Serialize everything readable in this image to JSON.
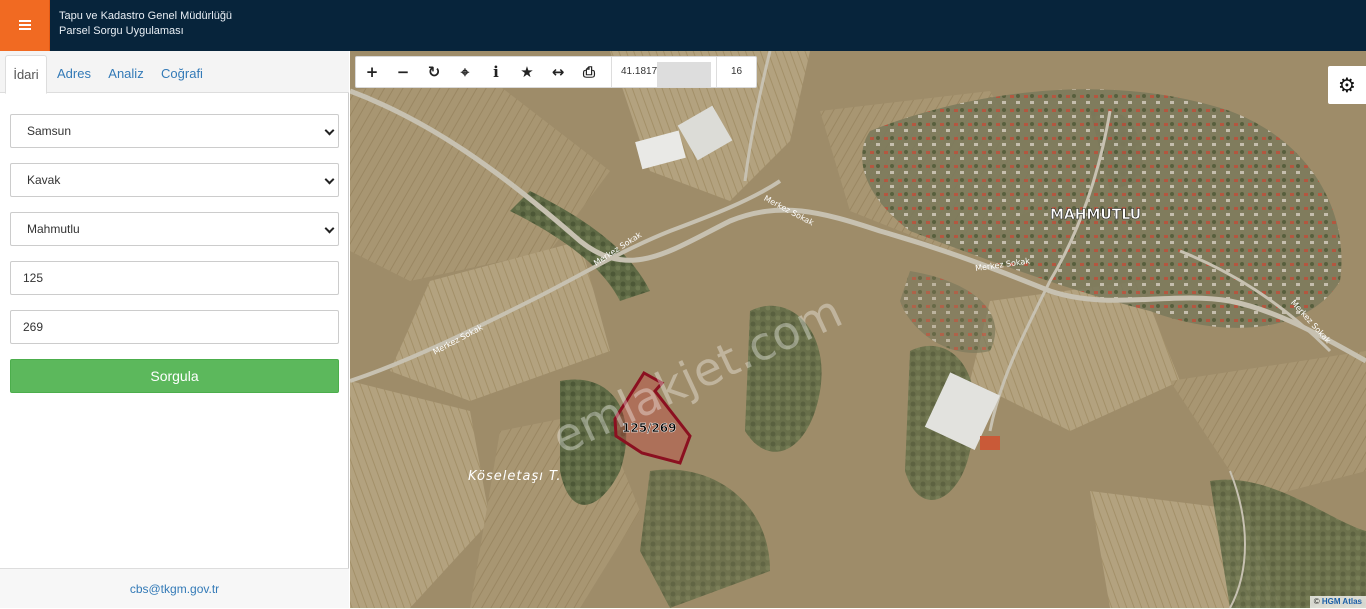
{
  "header": {
    "title_line1": "Tapu ve Kadastro Genel Müdürlüğü",
    "title_line2": "Parsel Sorgu Uygulaması",
    "menu_icon": "hamburger-icon"
  },
  "sidebar": {
    "tabs": [
      {
        "label": "İdari",
        "active": true
      },
      {
        "label": "Adres",
        "active": false
      },
      {
        "label": "Analiz",
        "active": false
      },
      {
        "label": "Coğrafi",
        "active": false
      }
    ],
    "form": {
      "il": "Samsun",
      "ilce": "Kavak",
      "mahalle": "Mahmutlu",
      "ada": "125",
      "parsel": "269",
      "submit_label": "Sorgula"
    },
    "footer_email": "cbs@tkgm.gov.tr"
  },
  "map": {
    "toolbar": {
      "buttons": [
        {
          "name": "zoom-in-icon",
          "glyph": "+"
        },
        {
          "name": "zoom-out-icon",
          "glyph": "−"
        },
        {
          "name": "refresh-icon",
          "glyph": "↻"
        },
        {
          "name": "locate-icon",
          "glyph": "⌖"
        },
        {
          "name": "info-icon",
          "glyph": "i"
        },
        {
          "name": "star-icon",
          "glyph": "★"
        },
        {
          "name": "measure-icon",
          "glyph": "↔"
        },
        {
          "name": "print-icon",
          "glyph": "⎙"
        }
      ],
      "coordinate": "41.1817",
      "zoom_level": "16"
    },
    "labels": {
      "village": "MAHMUTLU",
      "hill": "Köseletaşı T.",
      "parcel": "125/269",
      "street": "Merkez Sokak",
      "watermark": "emlakjet.com"
    },
    "attribution": {
      "prefix": "©",
      "link": "HGM Atlas"
    },
    "settings_icon": "gear-icon"
  },
  "colors": {
    "header_bg": "#07243b",
    "menu_bg": "#f16a22",
    "button_green": "#5cb85c",
    "link_blue": "#337ab7",
    "parcel_outline": "#8b1020"
  }
}
